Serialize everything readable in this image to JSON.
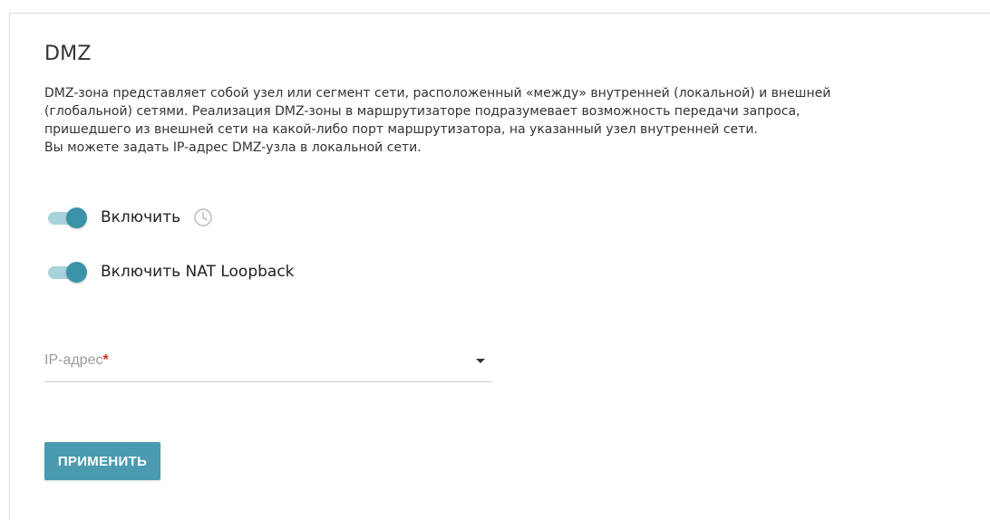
{
  "page": {
    "title": "DMZ",
    "description": [
      "DMZ-зона представляет собой узел или сегмент сети, расположенный «между» внутренней (локальной) и внешней",
      "(глобальной) сетями. Реализация DMZ-зоны в маршрутизаторе подразумевает возможность передачи запроса,",
      "пришедшего из внешней сети на какой-либо порт маршрутизатора, на указанный узел внутренней сети.",
      "Вы можете задать IP-адрес DMZ-узла в локальной сети."
    ]
  },
  "toggles": {
    "enable": {
      "label": "Включить",
      "on": true,
      "icon": "clock-icon"
    },
    "nat_loopback": {
      "label": "Включить NAT Loopback",
      "on": true
    }
  },
  "ip_field": {
    "label": "IP-адрес",
    "required_mark": "*",
    "value": ""
  },
  "actions": {
    "apply_label": "ПРИМЕНИТЬ"
  },
  "colors": {
    "accent": "#4a9bb0",
    "toggle_knob": "#3b93a9",
    "toggle_track": "#a9d3dc",
    "required": "#d0342c"
  }
}
